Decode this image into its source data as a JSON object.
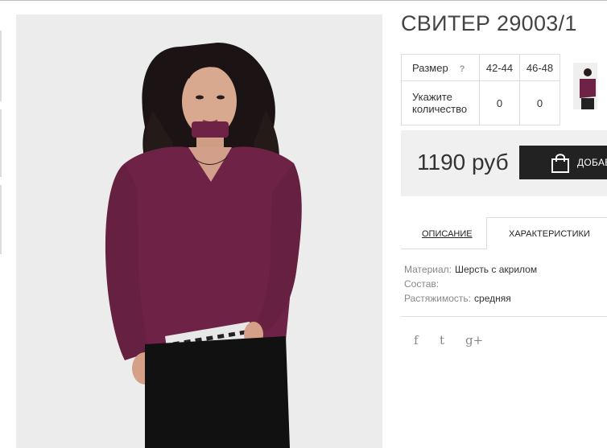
{
  "product": {
    "title": "СВИТЕР 29003/1",
    "image_alt": "Женщина в бордовом свитере"
  },
  "sizes": {
    "size_label": "Размер",
    "hint": "?",
    "options": [
      "42-44",
      "46-48"
    ],
    "qty_label": "Укажите количество",
    "quantities": [
      "0",
      "0"
    ]
  },
  "buy": {
    "price": "1190 руб",
    "add_label": "ДОБАВ"
  },
  "tabs": {
    "description": "ОПИСАНИЕ",
    "characteristics": "ХАРАКТЕРИСТИКИ",
    "active": "characteristics"
  },
  "specs": [
    {
      "label": "Материал:",
      "value": "Шерсть с акрилом"
    },
    {
      "label": "Состав:",
      "value": ""
    },
    {
      "label": "Растяжимость:",
      "value": "средняя"
    }
  ],
  "social": {
    "facebook": "f",
    "twitter": "t",
    "googleplus": "g+"
  },
  "colors": {
    "sweater": "#6e2346",
    "tab_button": "#222222",
    "buybox_bg": "#f0f0f0"
  }
}
